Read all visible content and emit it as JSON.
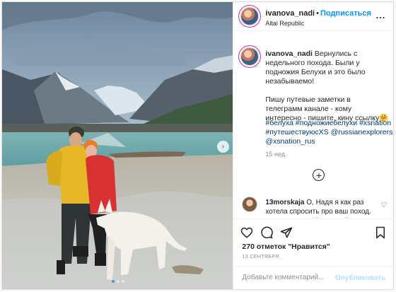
{
  "header": {
    "username": "ivanova_nadi",
    "separator": "•",
    "follow_label": "Подписаться",
    "location": "Altai Republic",
    "more_label": "..."
  },
  "caption": {
    "username": "ivanova_nadi",
    "text": "Вернулись с недельного похода. Были у подножия Белухи и это было незабываемо!",
    "text2": "Пишу путевые заметки в телеграмм канале - кому интересно - пишите, кину ссылку🤗",
    "hashtags": "#белуха #подножиебелухи #xsnation #путешествуюсXS @russianexplorers @xsnation_rus",
    "age": "15 нед."
  },
  "load_more_label": "+",
  "comment": {
    "username": "13morskaja",
    "text": "О, Надя я как раз хотела спросить про ваш поход. Делись ссылкой пожалуйста"
  },
  "actions": {
    "like_icon": "heart-icon",
    "comment_icon": "comment-icon",
    "share_icon": "paper-plane-icon",
    "save_icon": "bookmark-icon"
  },
  "likes_text": "270 отметок \"Нравится\"",
  "date_text": "13 СЕНТЯБРЯ",
  "add_comment": {
    "placeholder": "Добавьте комментарий...",
    "publish_label": "Опубликовать"
  },
  "carousel": {
    "next_label": "›",
    "slide_count": 3,
    "active_slide": 1
  },
  "colors": {
    "follow_blue": "#0095f6",
    "hashtag_blue": "#00376b",
    "muted_gray": "#8e8e8e",
    "publish_disabled": "#b2dffc"
  }
}
